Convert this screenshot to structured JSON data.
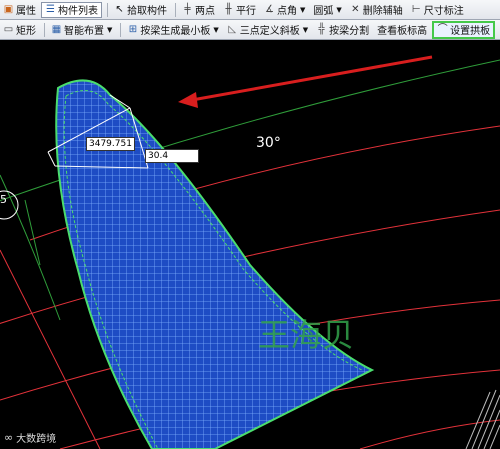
{
  "toolbar1": {
    "properties": "属性",
    "component_list": "构件列表",
    "pick_component": "拾取构件",
    "two_points": "两点",
    "parallel": "平行",
    "point_angle": "点角",
    "arc": "圆弧",
    "delete_aux": "删除辅轴",
    "dim_label": "尺寸标注"
  },
  "toolbar2": {
    "rect": "矩形",
    "smart_layout": "智能布置",
    "gen_by_beam_min": "按梁生成最小板",
    "three_point_slope": "三点定义斜板",
    "split_by_beam": "按梁分割",
    "view_slab_label": "查看板标高",
    "set_arch_slab": "设置拱板"
  },
  "canvas": {
    "dimension_value": "3479.751",
    "angle_input": "30.4",
    "angle_label": "30°",
    "side_number": "5",
    "watermark": "王海贝",
    "logo_text": "大数跨境"
  },
  "colors": {
    "annotation_red": "#d81e1e",
    "highlight_green": "#45c94a",
    "mesh_blue": "#1e5bd6",
    "grid_line": "#4a8cff",
    "arc_red": "#e3323a",
    "arc_green": "#2f9d3a"
  }
}
